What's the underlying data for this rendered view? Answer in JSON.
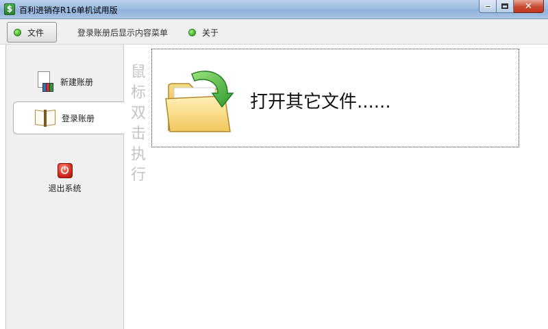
{
  "window": {
    "title": "百利进销存R16单机试用版",
    "app_icon_glyph": "$",
    "buttons": {
      "minimize": "minimize-icon",
      "maximize": "maximize-icon",
      "close": "close-icon"
    }
  },
  "menu": {
    "file_label": "文件",
    "login_hint": "登录账册后显示内容菜单",
    "about_label": "关于"
  },
  "sidebar": {
    "new_book_label": "新建账册",
    "login_label": "登录账册",
    "exit_label": "退出系统"
  },
  "main": {
    "hint_chars": [
      "鼠",
      "标",
      "双",
      "击",
      "执",
      "行"
    ],
    "open_file_label": "打开其它文件......"
  },
  "colors": {
    "titlebar": "#9cbbe0",
    "status_dot": "#3fae25",
    "power_red": "#d0281c",
    "folder_yellow": "#f4d77a",
    "arrow_green": "#3aa63a",
    "hint_gray": "#c4c4c4"
  }
}
